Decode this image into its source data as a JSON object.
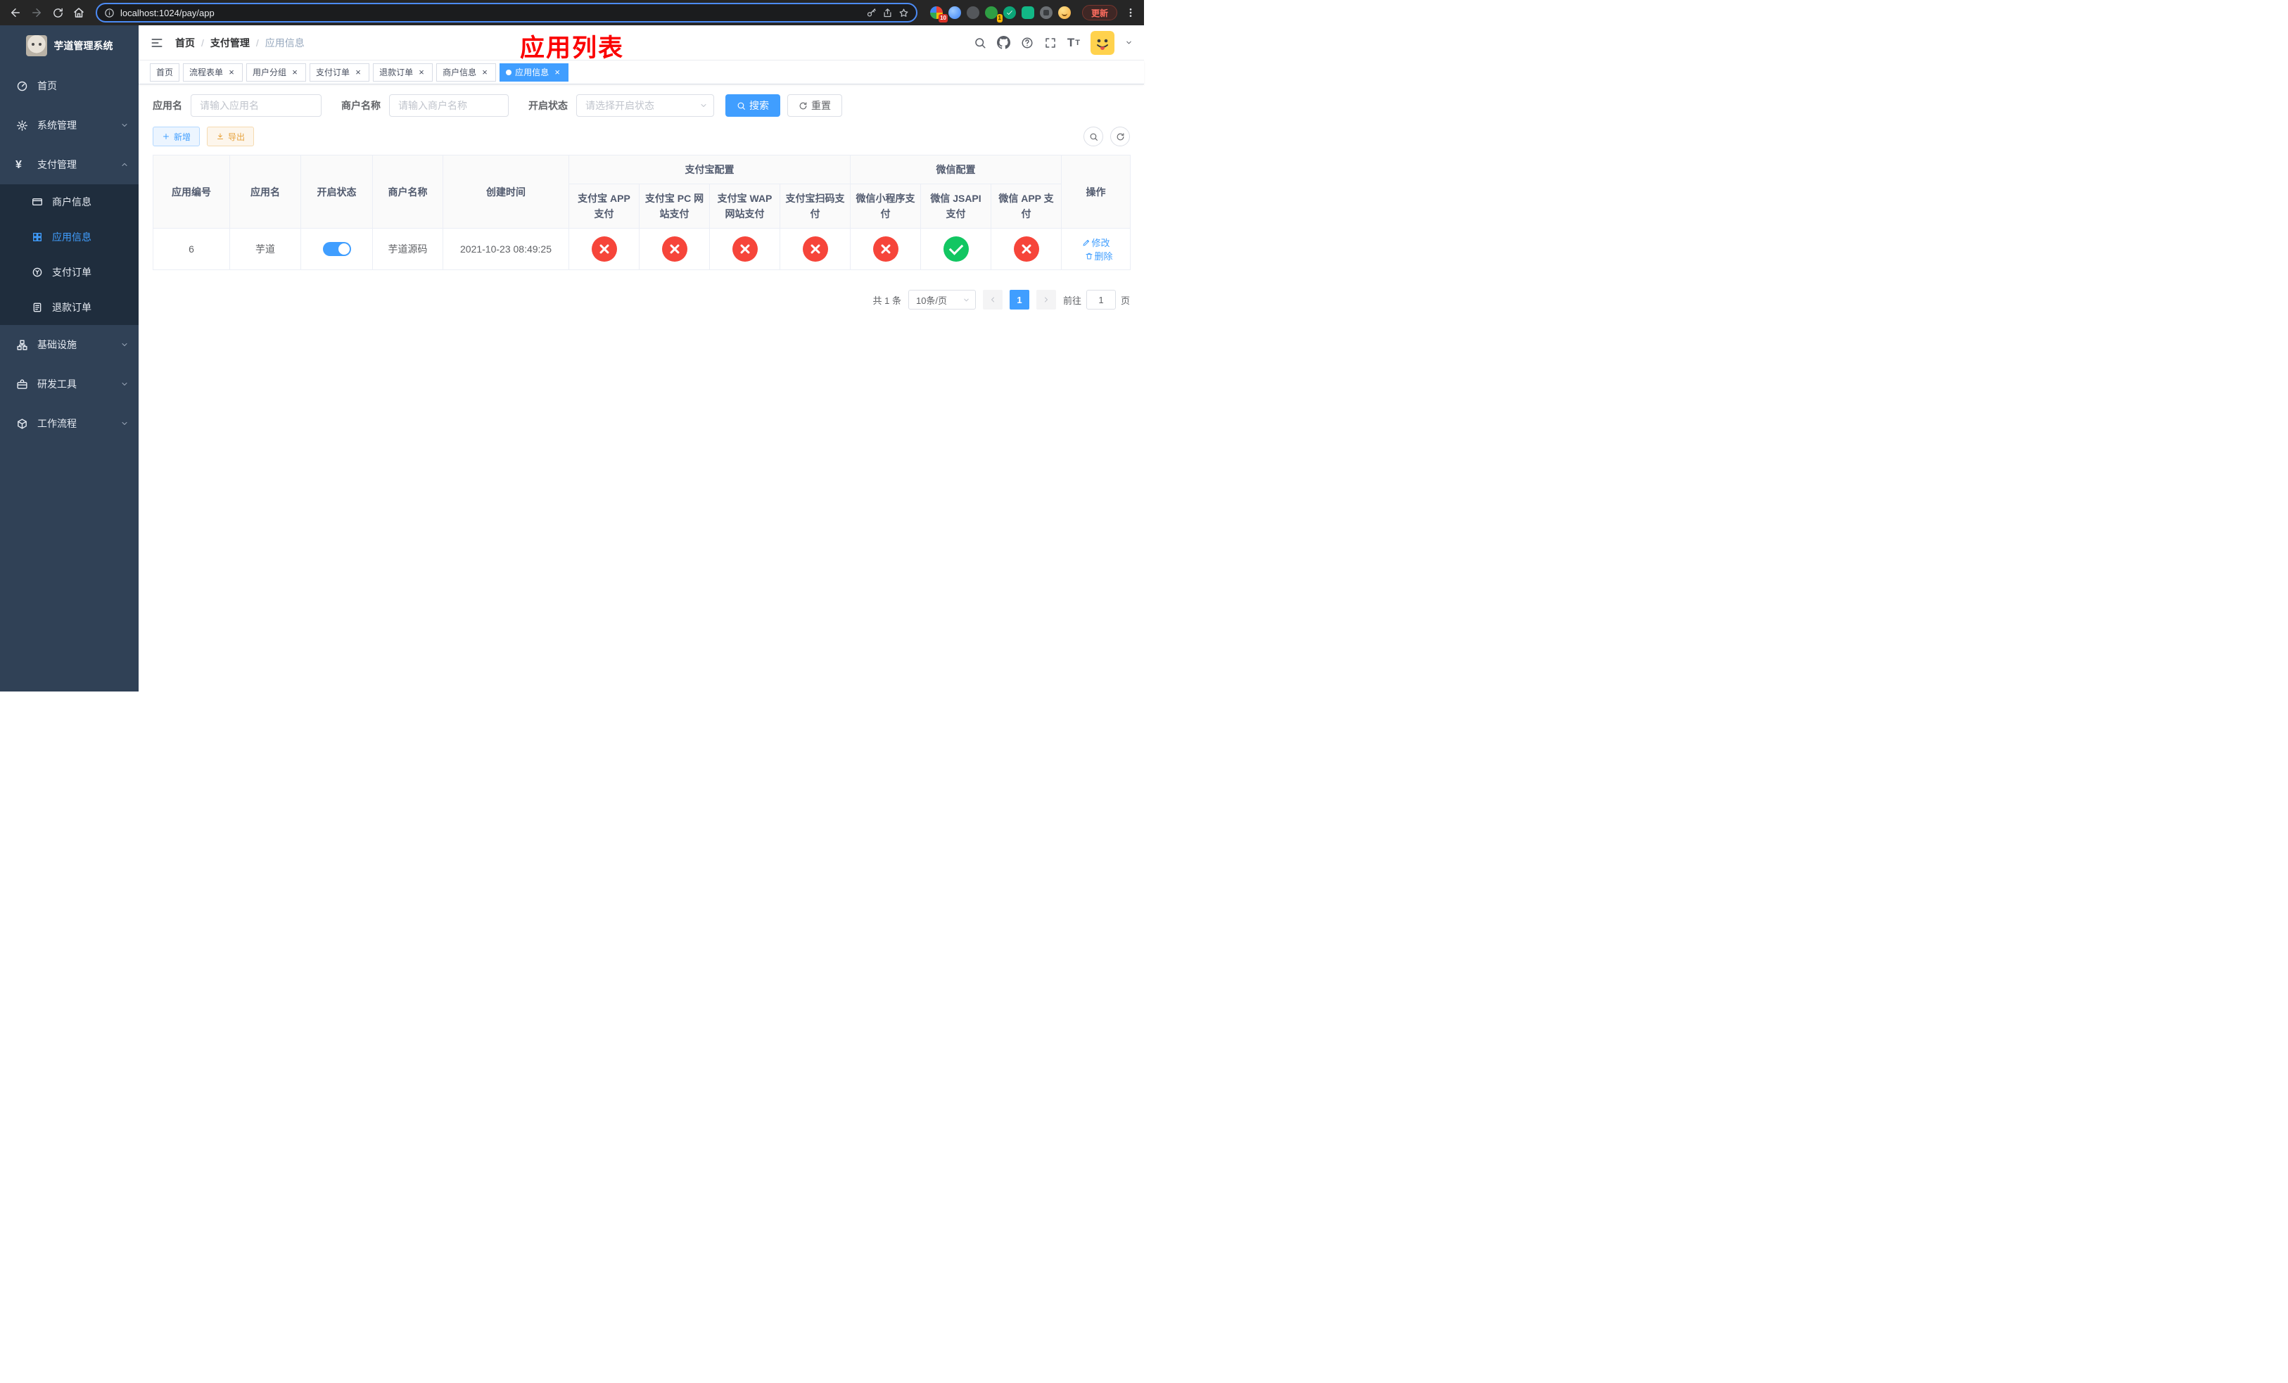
{
  "colors": {
    "accent": "#409eff",
    "danger": "#f6453a",
    "success": "#12c662",
    "warning": "#e6a23c",
    "sidebar_bg": "#304156",
    "annotation_red": "#fb0000"
  },
  "browser": {
    "url": "localhost:1024/pay/app",
    "update_label": "更新",
    "extension_badges": {
      "first": "10",
      "second": "1"
    }
  },
  "sidebar": {
    "title": "芋道管理系统",
    "items": [
      {
        "label": "首页"
      },
      {
        "label": "系统管理"
      },
      {
        "label": "支付管理"
      },
      {
        "label": "基础设施"
      },
      {
        "label": "研发工具"
      },
      {
        "label": "工作流程"
      }
    ],
    "payment_children": [
      {
        "label": "商户信息",
        "state": "inactive"
      },
      {
        "label": "应用信息",
        "state": "active"
      },
      {
        "label": "支付订单",
        "state": "inactive"
      },
      {
        "label": "退款订单",
        "state": "inactive"
      }
    ]
  },
  "annotation": {
    "title": "应用列表"
  },
  "breadcrumb": {
    "items": [
      {
        "label": "首页"
      },
      {
        "label": "支付管理"
      },
      {
        "label": "应用信息"
      }
    ]
  },
  "tabs": [
    {
      "label": "首页",
      "state": "inactive"
    },
    {
      "label": "流程表单",
      "state": "inactive"
    },
    {
      "label": "用户分组",
      "state": "inactive"
    },
    {
      "label": "支付订单",
      "state": "inactive"
    },
    {
      "label": "退款订单",
      "state": "inactive"
    },
    {
      "label": "商户信息",
      "state": "inactive"
    },
    {
      "label": "应用信息",
      "state": "active"
    }
  ],
  "filters": {
    "app_name_label": "应用名",
    "app_name_placeholder": "请输入应用名",
    "merchant_label": "商户名称",
    "merchant_placeholder": "请输入商户名称",
    "status_label": "开启状态",
    "status_placeholder": "请选择开启状态",
    "search_label": "搜索",
    "reset_label": "重置"
  },
  "toolbar": {
    "add_label": "新增",
    "export_label": "导出"
  },
  "table": {
    "headers": {
      "app_id": "应用编号",
      "app_name": "应用名",
      "status": "开启状态",
      "merchant": "商户名称",
      "created": "创建时间",
      "alipay_group": "支付宝配置",
      "wechat_group": "微信配置",
      "alipay_app": "支付宝 APP 支付",
      "alipay_pc": "支付宝 PC 网站支付",
      "alipay_wap": "支付宝 WAP 网站支付",
      "alipay_qr": "支付宝扫码支付",
      "wx_lite": "微信小程序支付",
      "wx_jsapi": "微信 JSAPI 支付",
      "wx_app": "微信 APP 支付",
      "actions": "操作"
    },
    "rows": [
      {
        "app_id": "6",
        "app_name": "芋道",
        "status": "on",
        "merchant": "芋道源码",
        "created": "2021-10-23 08:49:25",
        "alipay_app": "no",
        "alipay_pc": "no",
        "alipay_wap": "no",
        "alipay_qr": "no",
        "wx_lite": "no",
        "wx_jsapi": "yes",
        "wx_app": "no",
        "edit_label": "修改",
        "delete_label": "删除"
      }
    ]
  },
  "pagination": {
    "total_label": "共 1 条",
    "page_size_label": "10条/页",
    "current_page": "1",
    "goto_prefix": "前往",
    "goto_value": "1",
    "goto_suffix": "页"
  }
}
